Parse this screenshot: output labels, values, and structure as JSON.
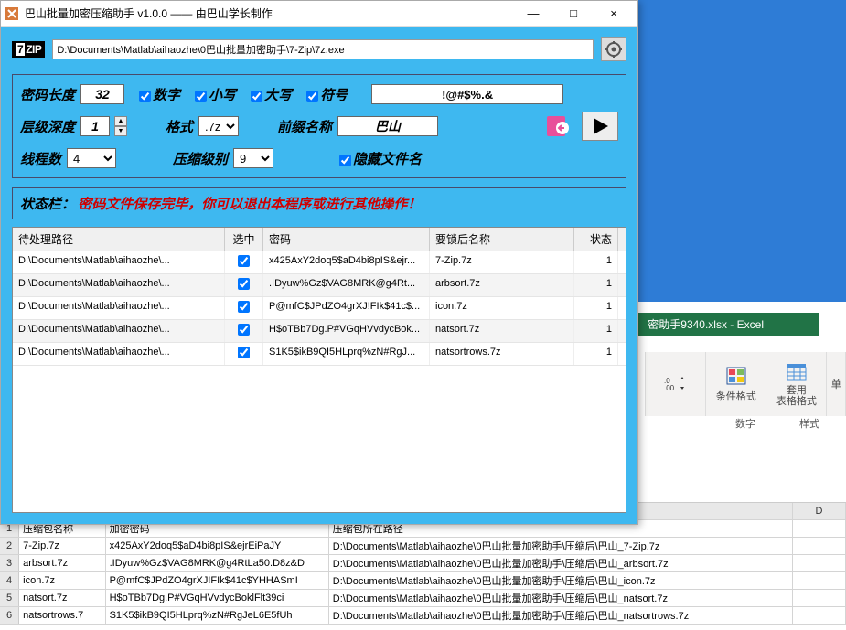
{
  "window": {
    "title": "巴山批量加密压缩助手 v1.0.0 —— 由巴山学长制作",
    "minimize": "—",
    "maximize": "□",
    "close": "×"
  },
  "zip_logo_a": "7",
  "zip_logo_b": "ZIP",
  "exe_path": "D:\\Documents\\Matlab\\aihaozhe\\0巴山批量加密助手\\7-Zip\\7z.exe",
  "settings": {
    "pwd_len_label": "密码长度",
    "pwd_len": "32",
    "chk_digit": "数字",
    "chk_lower": "小写",
    "chk_upper": "大写",
    "chk_symbol": "符号",
    "symbols": "!@#$%.&",
    "depth_label": "层级深度",
    "depth": "1",
    "format_label": "格式",
    "format": ".7z",
    "prefix_label": "前缀名称",
    "prefix": "巴山",
    "threads_label": "线程数",
    "threads": "4",
    "level_label": "压缩级别",
    "level": "9",
    "hide_label": "隐藏文件名"
  },
  "status": {
    "label": "状态栏：",
    "text": "密码文件保存完毕，你可以退出本程序或进行其他操作！"
  },
  "table": {
    "headers": {
      "path": "待处理路径",
      "sel": "选中",
      "pwd": "密码",
      "name": "要锁后名称",
      "stat": "状态"
    },
    "rows": [
      {
        "path": "D:\\Documents\\Matlab\\aihaozhe\\...",
        "sel": true,
        "pwd": "x425AxY2doq5$aD4bi8pIS&ejr...",
        "name": "7-Zip.7z",
        "stat": "1"
      },
      {
        "path": "D:\\Documents\\Matlab\\aihaozhe\\...",
        "sel": true,
        "pwd": ".IDyuw%Gz$VAG8MRK@g4Rt...",
        "name": "arbsort.7z",
        "stat": "1"
      },
      {
        "path": "D:\\Documents\\Matlab\\aihaozhe\\...",
        "sel": true,
        "pwd": "P@mfC$JPdZO4grXJ!FIk$41c$...",
        "name": "icon.7z",
        "stat": "1"
      },
      {
        "path": "D:\\Documents\\Matlab\\aihaozhe\\...",
        "sel": true,
        "pwd": "H$oTBb7Dg.P#VGqHVvdycBok...",
        "name": "natsort.7z",
        "stat": "1"
      },
      {
        "path": "D:\\Documents\\Matlab\\aihaozhe\\...",
        "sel": true,
        "pwd": "S1K5$ikB9QI5HLprq%zN#RgJ...",
        "name": "natsortrows.7z",
        "stat": "1"
      }
    ]
  },
  "excel": {
    "title": "密助手9340.xlsx - Excel",
    "cond_fmt": "条件格式",
    "table_fmt": "套用\n表格格式",
    "single": "单",
    "numfmt": "数字",
    "style": "样式",
    "col_d": "D",
    "headers": {
      "a": "压缩包名称",
      "b": "加密密码",
      "c": "压缩包所在路径"
    },
    "rows": [
      {
        "n": "2",
        "a": "7-Zip.7z",
        "b": "x425AxY2doq5$aD4bi8pIS&ejrEiPaJY",
        "c": "D:\\Documents\\Matlab\\aihaozhe\\0巴山批量加密助手\\压缩后\\巴山_7-Zip.7z"
      },
      {
        "n": "3",
        "a": "arbsort.7z",
        "b": ".IDyuw%Gz$VAG8MRK@g4RtLa50.D8z&D",
        "c": "D:\\Documents\\Matlab\\aihaozhe\\0巴山批量加密助手\\压缩后\\巴山_arbsort.7z"
      },
      {
        "n": "4",
        "a": "icon.7z",
        "b": "P@mfC$JPdZO4grXJ!FIk$41c$YHHASmI",
        "c": "D:\\Documents\\Matlab\\aihaozhe\\0巴山批量加密助手\\压缩后\\巴山_icon.7z"
      },
      {
        "n": "5",
        "a": "natsort.7z",
        "b": "H$oTBb7Dg.P#VGqHVvdycBoklFlt39ci",
        "c": "D:\\Documents\\Matlab\\aihaozhe\\0巴山批量加密助手\\压缩后\\巴山_natsort.7z"
      },
      {
        "n": "6",
        "a": "natsortrows.7",
        "b": "S1K5$ikB9QI5HLprq%zN#RgJeL6E5fUh",
        "c": "D:\\Documents\\Matlab\\aihaozhe\\0巴山批量加密助手\\压缩后\\巴山_natsortrows.7z"
      }
    ]
  }
}
